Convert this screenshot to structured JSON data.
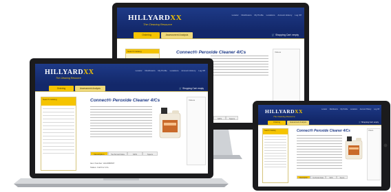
{
  "site": {
    "logo_text": "HILLYARD",
    "logo_mark": "XX",
    "tagline": "The Cleaning Resource",
    "top_links": [
      "Locator",
      "Distributors",
      "My Profile",
      "Locations",
      "Account History",
      "Log Off"
    ],
    "nav_tabs": [
      "Ordering",
      "Assessment Analysis"
    ],
    "cart_label": "Shopping Cart: empty",
    "sidebar_title": "Search Catalog",
    "product_title": "Connect® Peroxide Cleaner 4/Cs",
    "right_panel_label": "Videos",
    "detail_tabs": [
      "Description",
      "Technical Data",
      "SDS",
      "Specs"
    ],
    "item_label": "Item Number: HIL0080507",
    "price_label": "Status: Call For Info"
  }
}
